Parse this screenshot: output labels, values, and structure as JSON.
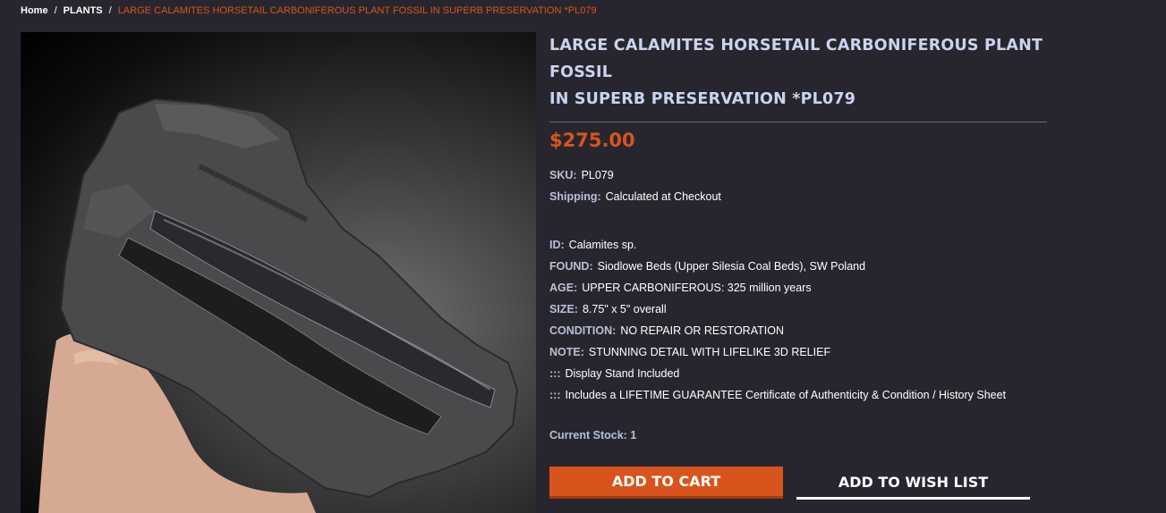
{
  "breadcrumb": {
    "home": "Home",
    "category": "PLANTS",
    "current": "LARGE CALAMITES HORSETAIL CARBONIFEROUS PLANT FOSSIL IN SUPERB PRESERVATION *PL079",
    "separator": "/"
  },
  "product": {
    "title_line1": "LARGE CALAMITES HORSETAIL CARBONIFEROUS PLANT FOSSIL",
    "title_line2": "IN SUPERB PRESERVATION *PL079",
    "price": "$275.00",
    "sku_label": "SKU:",
    "sku": "PL079",
    "shipping_label": "Shipping:",
    "shipping": "Calculated at Checkout",
    "details": [
      {
        "label": "ID:",
        "value": "Calamites sp."
      },
      {
        "label": "FOUND:",
        "value": "Siodlowe Beds (Upper Silesia Coal Beds), SW Poland"
      },
      {
        "label": "AGE:",
        "value": "UPPER CARBONIFEROUS: 325 million years"
      },
      {
        "label": "SIZE:",
        "value": "8.75\" x 5\" overall"
      },
      {
        "label": "CONDITION:",
        "value": "NO REPAIR OR RESTORATION"
      },
      {
        "label": "NOTE:",
        "value": "STUNNING DETAIL WITH LIFELIKE 3D RELIEF"
      },
      {
        "label": ":::",
        "value": "Display Stand Included"
      },
      {
        "label": ":::",
        "value": "Includes a LIFETIME GUARANTEE Certificate of Authenticity & Condition / History Sheet"
      }
    ],
    "stock_label": "Current Stock:",
    "stock": "1"
  },
  "actions": {
    "add_to_cart": "ADD TO CART",
    "add_to_wishlist": "ADD TO WISH LIST"
  },
  "colors": {
    "background": "#27262e",
    "accent": "#d9541c",
    "title": "#c9d4ee",
    "label": "#b7c0d6"
  }
}
